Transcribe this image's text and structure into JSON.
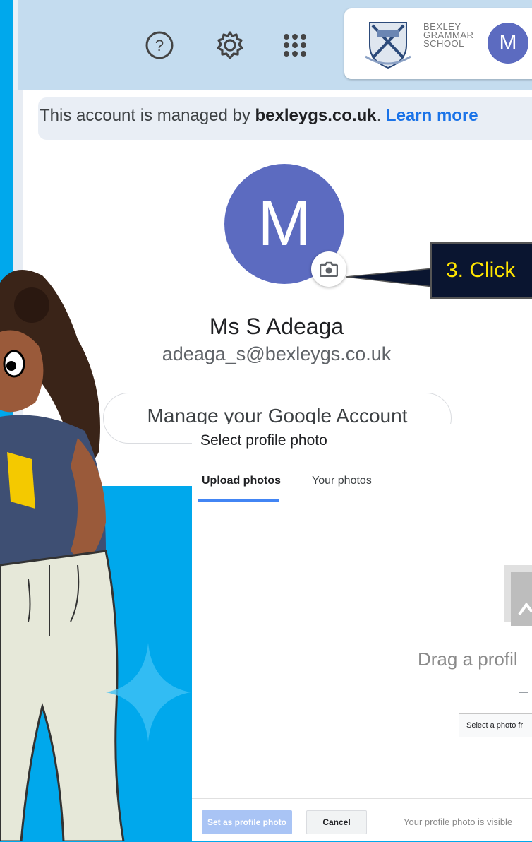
{
  "header": {
    "help_icon": "help-circle-icon",
    "settings_icon": "gear-icon",
    "apps_icon": "apps-grid-icon",
    "school_name_line1": "BEXLEY",
    "school_name_line2": "GRAMMAR",
    "school_name_line3": "SCHOOL",
    "avatar_initial": "M"
  },
  "account_popup": {
    "managed_prefix": "This account is managed by ",
    "managed_domain": "bexleygs.co.uk",
    "managed_suffix": ". ",
    "learn_more": "Learn more",
    "avatar_initial": "M",
    "camera_icon": "camera-icon",
    "user_name": "Ms S Adeaga",
    "user_email": "adeaga_s@bexleygs.co.uk",
    "manage_account": "Manage your Google Account"
  },
  "callout": {
    "text": "3. Click"
  },
  "photo_dialog": {
    "title": "Select profile photo",
    "tabs": [
      {
        "label": "Upload photos",
        "active": true
      },
      {
        "label": "Your photos",
        "active": false
      }
    ],
    "drag_text": "Drag a profil",
    "divider": "–",
    "select_photo_button": "Select a photo fr",
    "set_button": "Set as profile photo",
    "cancel_button": "Cancel",
    "visibility_note": "Your profile photo is visible"
  },
  "colors": {
    "background": "#00a8ec",
    "avatar": "#5c6bc0",
    "link": "#1a73e8",
    "callout_bg": "#0a1530",
    "callout_text": "#ffe400"
  }
}
